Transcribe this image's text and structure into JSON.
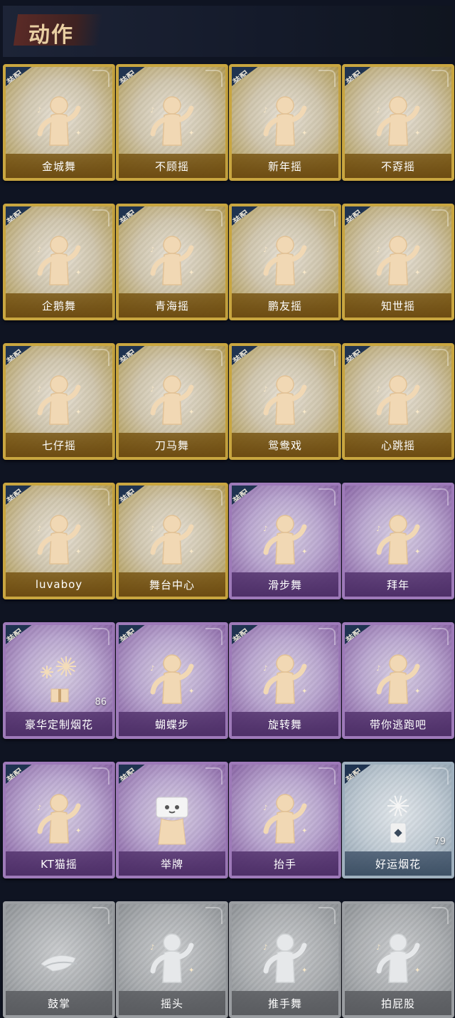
{
  "header": {
    "title": "动作"
  },
  "equip_label": "装配",
  "colors": {
    "gold": "#c9a640",
    "purple": "#9e7ab9",
    "blue": "#9fb0be",
    "gray": "#9a9da1",
    "badge": "#1f3350"
  },
  "cards": [
    {
      "name": "金城舞",
      "tier": "gold",
      "equipped": true,
      "icon": "dancer-wave-icon"
    },
    {
      "name": "不顾摇",
      "tier": "gold",
      "equipped": true,
      "icon": "dancer-point-icon"
    },
    {
      "name": "新年摇",
      "tier": "gold",
      "equipped": true,
      "icon": "dancer-music-icon"
    },
    {
      "name": "不孬摇",
      "tier": "gold",
      "equipped": true,
      "icon": "dancer-raise-arm-icon"
    },
    {
      "name": "企鹅舞",
      "tier": "gold",
      "equipped": true,
      "icon": "dancer-penguin-icon"
    },
    {
      "name": "青海摇",
      "tier": "gold",
      "equipped": true,
      "icon": "dancer-shake-icon"
    },
    {
      "name": "鹏友摇",
      "tier": "gold",
      "equipped": true,
      "icon": "dancer-sway-icon"
    },
    {
      "name": "知世摇",
      "tier": "gold",
      "equipped": true,
      "icon": "dancer-music-icon"
    },
    {
      "name": "七仔摇",
      "tier": "gold",
      "equipped": true,
      "icon": "dancer-cross-arm-icon"
    },
    {
      "name": "刀马舞",
      "tier": "gold",
      "equipped": true,
      "icon": "dancer-sparkle-icon"
    },
    {
      "name": "鸳鸯戏",
      "tier": "gold",
      "equipped": true,
      "icon": "dancer-music-icon"
    },
    {
      "name": "心跳摇",
      "tier": "gold",
      "equipped": true,
      "icon": "dancer-raise-arm-icon"
    },
    {
      "name": "luvaboy",
      "tier": "gold",
      "equipped": true,
      "icon": "dancer-sway-icon"
    },
    {
      "name": "舞台中心",
      "tier": "gold",
      "equipped": true,
      "icon": "dancer-stage-icon"
    },
    {
      "name": "滑步舞",
      "tier": "purple",
      "equipped": true,
      "icon": "dancer-music-icon"
    },
    {
      "name": "拜年",
      "tier": "purple",
      "equipped": false,
      "icon": "dancer-bow-icon"
    },
    {
      "name": "豪华定制烟花",
      "tier": "purple",
      "equipped": true,
      "icon": "fireworks-box-icon",
      "count": "86"
    },
    {
      "name": "蝴蝶步",
      "tier": "purple",
      "equipped": true,
      "icon": "dancer-point-icon"
    },
    {
      "name": "旋转舞",
      "tier": "purple",
      "equipped": true,
      "icon": "dancer-spin-icon"
    },
    {
      "name": "带你逃跑吧",
      "tier": "purple",
      "equipped": true,
      "icon": "dancer-run-icon"
    },
    {
      "name": "KT猫摇",
      "tier": "purple",
      "equipped": true,
      "icon": "dancer-music-icon"
    },
    {
      "name": "举牌",
      "tier": "purple",
      "equipped": true,
      "icon": "sign-holder-icon"
    },
    {
      "name": "抬手",
      "tier": "purple",
      "equipped": false,
      "icon": "dancer-raise-hand-icon"
    },
    {
      "name": "好运烟花",
      "tier": "blue",
      "equipped": true,
      "icon": "firework-can-icon",
      "count": "79"
    },
    {
      "name": "鼓掌",
      "tier": "gray",
      "equipped": false,
      "icon": "clap-hands-icon"
    },
    {
      "name": "摇头",
      "tier": "gray",
      "equipped": false,
      "icon": "dancer-headshake-icon"
    },
    {
      "name": "推手舞",
      "tier": "gray",
      "equipped": false,
      "icon": "dancer-push-icon"
    },
    {
      "name": "拍屁股",
      "tier": "gray",
      "equipped": false,
      "icon": "dancer-pat-icon"
    }
  ]
}
